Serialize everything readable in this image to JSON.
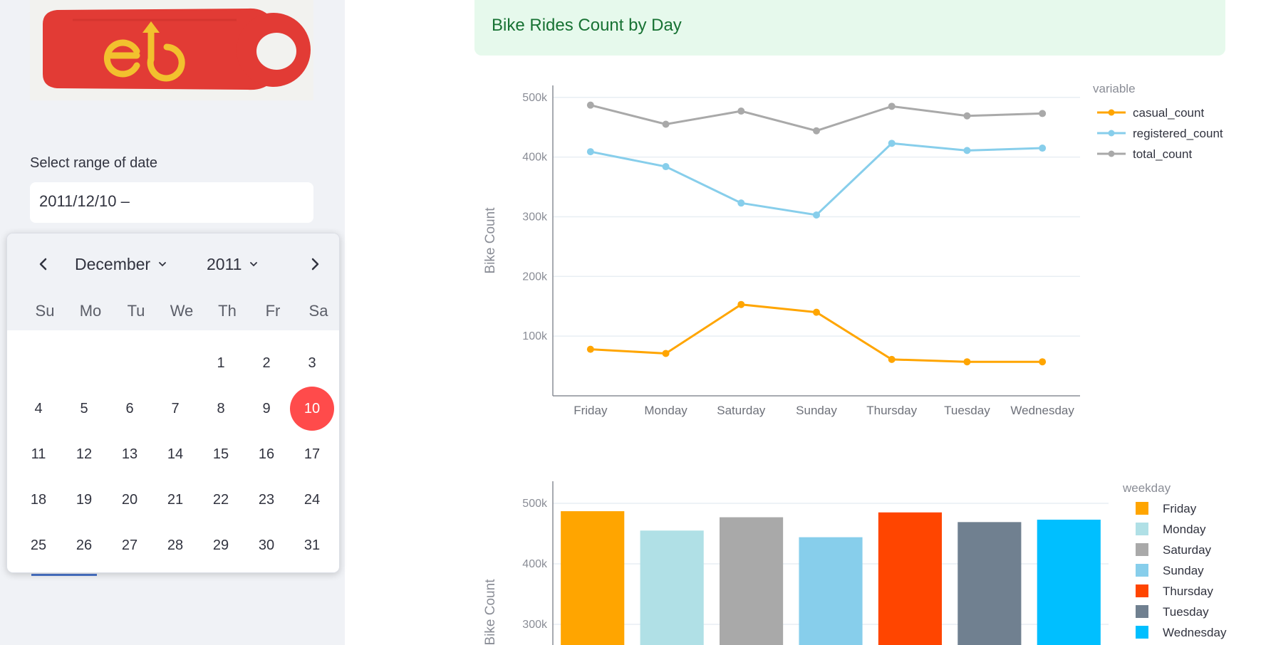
{
  "sidebar": {
    "logo": {
      "description": "red bicycle key fob logo",
      "colors": {
        "body": "#e23b35",
        "mark": "#f2c12e"
      }
    },
    "date_label": "Select range of date",
    "date_value": "2011/12/10 –"
  },
  "calendar": {
    "month": "December",
    "year": "2011",
    "weekday_headers": [
      "Su",
      "Mo",
      "Tu",
      "We",
      "Th",
      "Fr",
      "Sa"
    ],
    "weeks": [
      [
        "",
        "",
        "",
        "",
        "1",
        "2",
        "3"
      ],
      [
        "4",
        "5",
        "6",
        "7",
        "8",
        "9",
        "10"
      ],
      [
        "11",
        "12",
        "13",
        "14",
        "15",
        "16",
        "17"
      ],
      [
        "18",
        "19",
        "20",
        "21",
        "22",
        "23",
        "24"
      ],
      [
        "25",
        "26",
        "27",
        "28",
        "29",
        "30",
        "31"
      ]
    ],
    "selected_day": "10",
    "selected_color": "#ff4b4b"
  },
  "main": {
    "banner_title": "Bike Rides Count by Day"
  },
  "chart_data": [
    {
      "type": "line",
      "ylabel": "Bike Count",
      "xlabel": "",
      "legend_title": "variable",
      "legend_placement": "right",
      "categories": [
        "Friday",
        "Monday",
        "Saturday",
        "Sunday",
        "Thursday",
        "Tuesday",
        "Wednesday"
      ],
      "yticks": [
        "100k",
        "200k",
        "300k",
        "400k",
        "500k"
      ],
      "ylim": [
        0,
        520000
      ],
      "series": [
        {
          "name": "casual_count",
          "color": "#ffa500",
          "values": [
            78000,
            71000,
            153000,
            140000,
            61000,
            57000,
            57000
          ]
        },
        {
          "name": "registered_count",
          "color": "#87ceeb",
          "values": [
            409000,
            384000,
            323000,
            303000,
            423000,
            411000,
            415000
          ]
        },
        {
          "name": "total_count",
          "color": "#a9a9a9",
          "values": [
            487000,
            455000,
            477000,
            444000,
            485000,
            469000,
            473000
          ]
        }
      ]
    },
    {
      "type": "bar",
      "ylabel": "Bike Count",
      "xlabel": "",
      "legend_title": "weekday",
      "legend_placement": "right",
      "categories": [
        "Friday",
        "Monday",
        "Saturday",
        "Sunday",
        "Thursday",
        "Tuesday",
        "Wednesday"
      ],
      "values": [
        487000,
        455000,
        477000,
        444000,
        485000,
        469000,
        473000
      ],
      "colors": [
        "#ffa500",
        "#b0e0e6",
        "#a9a9a9",
        "#87ceeb",
        "#ff4500",
        "#708090",
        "#00bfff"
      ],
      "yticks": [
        "300k",
        "400k",
        "500k"
      ],
      "ylim": [
        0,
        520000
      ]
    }
  ]
}
